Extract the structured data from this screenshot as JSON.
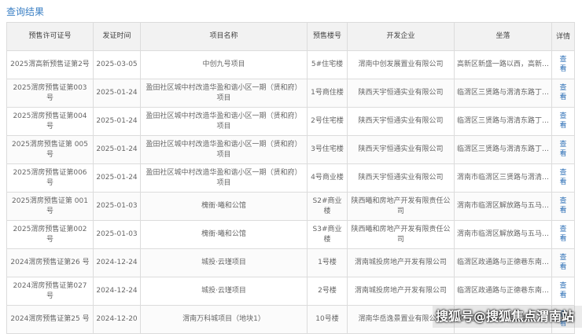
{
  "page": {
    "title": "查询结果"
  },
  "table": {
    "headers": [
      "预售许可证号",
      "发证时间",
      "项目名称",
      "预售楼号",
      "开发企业",
      "坐落",
      "详情"
    ],
    "view_label": "查看",
    "rows": [
      [
        "2025渭高新预售证第2号",
        "2025-03-05",
        "中创九号项目",
        "5#住宅楼",
        "渭南中创发展置业有限公司",
        "高新区新盛一路以西，高新…"
      ],
      [
        "2025渭房预售证第003号",
        "2025-01-24",
        "盈田社区城中村改造华盈和谐小区一期（贤和府）项目",
        "1号商住楼",
        "陕西天宇恒通实业有限公司",
        "临渭区三贤路与渭清东路丁…"
      ],
      [
        "2025渭房预售证第004 号",
        "2025-01-24",
        "盈田社区城中村改造华盈和谐小区一期（贤和府）项目",
        "2号住宅楼",
        "陕西天宇恒通实业有限公司",
        "临渭区三贤路与渭清东路丁…"
      ],
      [
        "2025渭房预售证第 005号",
        "2025-01-24",
        "盈田社区城中村改造华盈和谐小区一期（贤和府）项目",
        "3号住宅楼",
        "陕西天宇恒通实业有限公司",
        "临渭区三贤路与渭清东路丁…"
      ],
      [
        "2025渭房预售证第006 号",
        "2025-01-24",
        "盈田社区城中村改造华盈和谐小区一期（贤和府）项目",
        "4号商业楼",
        "陕西天宇恒通实业有限公司",
        "渭南市临渭区三贤路与渭清…"
      ],
      [
        "2025渭房预售证第 001号",
        "2025-01-03",
        "槐衙·曦和公馆",
        "S2#商业楼",
        "陕西曦和房地产开发有限责任公司",
        "渭南市临渭区解放路与五马…"
      ],
      [
        "2025渭房预售证第002 号",
        "2025-01-03",
        "槐衙·曦和公馆",
        "S3#商业楼",
        "陕西曦和房地产开发有限责任公司",
        "渭南市临渭区解放路与五马…"
      ],
      [
        "2024渭房预售证第26 号",
        "2024-12-24",
        "城投·云瑾项目",
        "1号楼",
        "渭南城投房地产开发有限公司",
        "临渭区政通路与正德巷东南…"
      ],
      [
        "2024渭房预售证第027 号",
        "2024-12-24",
        "城投·云瑾项目",
        "2号楼",
        "渭南城投房地产开发有限公司",
        "临渭区政通路与正德巷东南…"
      ],
      [
        "2024渭房预售证第25 号",
        "2024-12-20",
        "渭南万科城项目（地块1）",
        "10号楼",
        "渭南华岳逸景置业有限公司",
        "临渭区渭清路与华州路十…"
      ]
    ]
  },
  "watermark": "搜狐号@搜狐焦点渭南站"
}
